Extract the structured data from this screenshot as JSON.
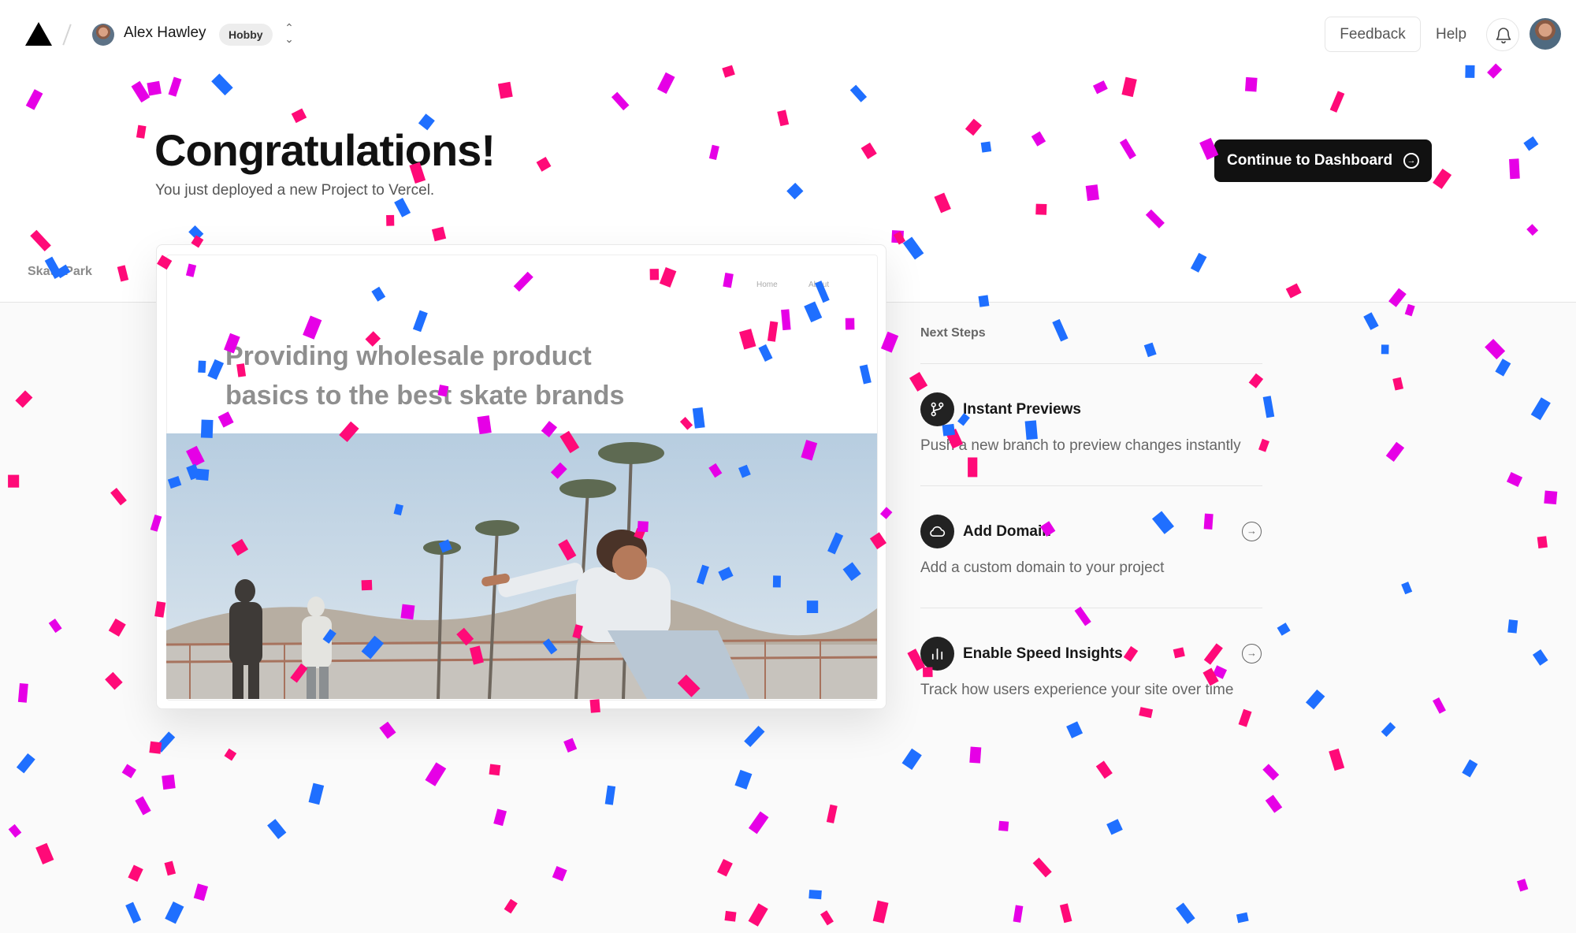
{
  "header": {
    "user_name": "Alex Hawley",
    "plan_badge": "Hobby",
    "feedback_label": "Feedback",
    "help_label": "Help"
  },
  "hero": {
    "title": "Congratulations!",
    "subtitle": "You just deployed a new Project to Vercel.",
    "continue_label": "Continue to Dashboard"
  },
  "preview": {
    "site_name": "Skate Park",
    "nav_home": "Home",
    "nav_about": "About",
    "headline_line1": "Providing wholesale product",
    "headline_line2": "basics to the best skate brands"
  },
  "next_steps": {
    "heading": "Next Steps",
    "items": [
      {
        "title": "Instant Previews",
        "description": "Push a new branch to preview changes instantly",
        "icon": "git-branch-icon"
      },
      {
        "title": "Add Domain",
        "description": "Add a custom domain to your project",
        "icon": "cloud-icon"
      },
      {
        "title": "Enable Speed Insights",
        "description": "Track how users experience your site over time",
        "icon": "bar-chart-icon"
      }
    ]
  },
  "colors": {
    "confetti": [
      "#ff0a78",
      "#1f6fff",
      "#e600e6"
    ],
    "primary_button": "#111111"
  }
}
